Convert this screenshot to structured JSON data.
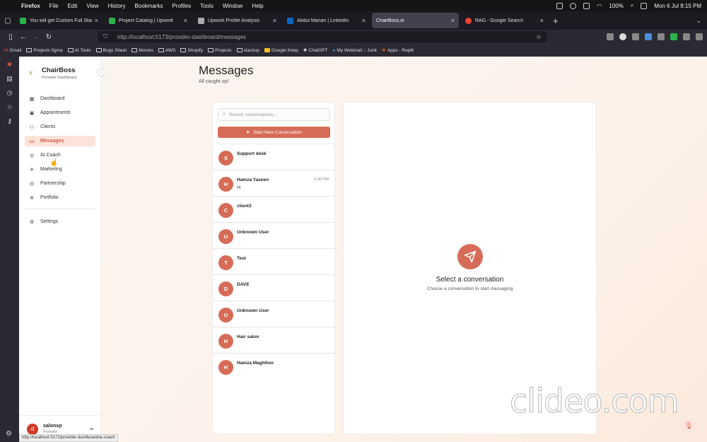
{
  "menubar": {
    "app": "Firefox",
    "items": [
      "File",
      "Edit",
      "View",
      "History",
      "Bookmarks",
      "Profiles",
      "Tools",
      "Window",
      "Help"
    ],
    "battery": "100%",
    "datetime": "Mon 6 Jul  8:15 PM"
  },
  "tabs": [
    {
      "title": "You will get Custom Full Stack D",
      "color": "#2bb24c"
    },
    {
      "title": "Project Catalog | Upwork",
      "color": "#2bb24c"
    },
    {
      "title": "Upwork Profile Analysis",
      "color": "#aaaaaa"
    },
    {
      "title": "Abdul Manan | LinkedIn",
      "color": "#0a66c2"
    },
    {
      "title": "ChairBoss.io",
      "color": "#888888"
    },
    {
      "title": "RAG - Google Search",
      "color": "#ea4335"
    }
  ],
  "url": "http://localhost:5173/provider-dashboard/messages",
  "bookmarks": [
    "Gmail",
    "Projects figma",
    "AI Tools",
    "Bugs Sheet",
    "Movies",
    "AWS",
    "Shopify",
    "Projects",
    "stackup",
    "Google Keep",
    "ChatGPT",
    "My Webmail :: Junk",
    "Apps - Replit"
  ],
  "brand": {
    "name": "ChairBoss",
    "subtitle": "Provider Dashboard"
  },
  "nav": [
    {
      "label": "Dashboard",
      "icon": "grid-icon",
      "glyph": "▦"
    },
    {
      "label": "Appointments",
      "icon": "calendar-icon",
      "glyph": "▣"
    },
    {
      "label": "Clients",
      "icon": "users-icon",
      "glyph": "⚇"
    },
    {
      "label": "Messages",
      "icon": "message-icon",
      "glyph": "▭",
      "active": true
    },
    {
      "label": "AI Coach",
      "icon": "brain-icon",
      "glyph": "◎"
    },
    {
      "label": "Marketing",
      "icon": "rocket-icon",
      "glyph": "✈"
    },
    {
      "label": "Partnership",
      "icon": "handshake-icon",
      "glyph": "⊟"
    },
    {
      "label": "Portfolio",
      "icon": "portfolio-icon",
      "glyph": "✲"
    }
  ],
  "settings_label": "Settings",
  "user": {
    "initial": "d",
    "name": "salonxp",
    "role": "Provider"
  },
  "header": {
    "title": "Messages",
    "subtitle": "All caught up!"
  },
  "search": {
    "placeholder": "Search conversations..."
  },
  "start_button": "Start New Conversation",
  "conversations": [
    {
      "initial": "S",
      "name": "Support desk",
      "message": "",
      "time": ""
    },
    {
      "initial": "H",
      "name": "Hamza Yaseen",
      "message": "Hi",
      "time": "2:43 PM"
    },
    {
      "initial": "C",
      "name": "client3",
      "message": "",
      "time": ""
    },
    {
      "initial": "U",
      "name": "Unknown User",
      "message": "",
      "time": ""
    },
    {
      "initial": "T",
      "name": "Test",
      "message": "",
      "time": ""
    },
    {
      "initial": "D",
      "name": "DAVE",
      "message": "",
      "time": ""
    },
    {
      "initial": "U",
      "name": "Unknown User",
      "message": "",
      "time": ""
    },
    {
      "initial": "H",
      "name": "Hair salon",
      "message": "",
      "time": ""
    },
    {
      "initial": "H",
      "name": "Hamza Maghfoor",
      "message": "",
      "time": ""
    }
  ],
  "empty_state": {
    "title": "Select a conversation",
    "subtitle": "Choose a conversation to start messaging"
  },
  "watermark": "clideo.com",
  "status_url": "http://localhost:5173/provider-dashboard/ai-coach",
  "accent": "#d66c57"
}
